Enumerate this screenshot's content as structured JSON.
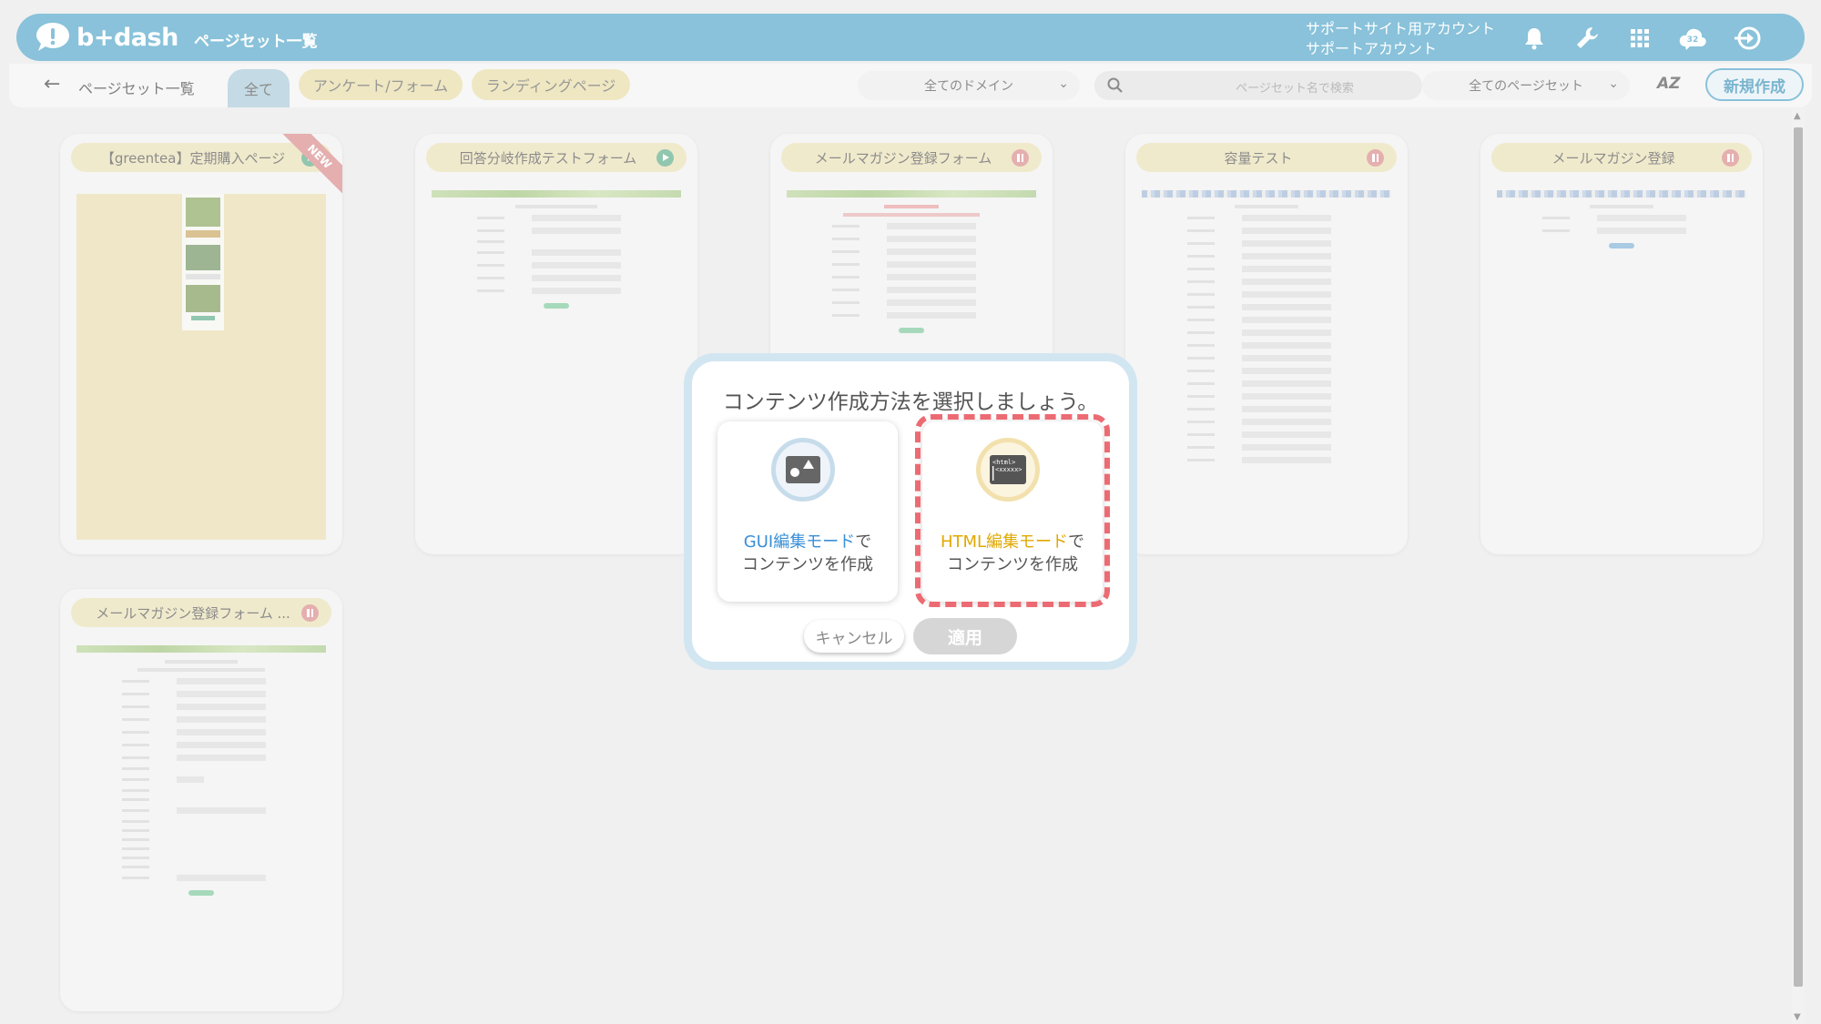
{
  "app": {
    "logo_text": "b+dash",
    "title": "ページセット一覧"
  },
  "account": {
    "line1": "サポートサイト用アカウント",
    "line2": "サポートアカウント"
  },
  "header_icons": [
    "bell-icon",
    "wrench-icon",
    "apps-grid-icon",
    "notification-cloud-icon",
    "logout-icon"
  ],
  "notification_count": "32",
  "toolbar": {
    "breadcrumb": "ページセット一覧",
    "tabs": [
      {
        "label": "全て",
        "active": true
      },
      {
        "label": "アンケート/フォーム",
        "active": false
      },
      {
        "label": "ランディングページ",
        "active": false
      }
    ],
    "domain_select": "全てのドメイン",
    "search_placeholder": "ページセット名で検索",
    "pageset_select": "全てのページセット",
    "sort_label": "AZ",
    "new_button": "新規作成"
  },
  "cards": [
    {
      "title": "【greentea】定期購入ページ",
      "status": "play",
      "new": true,
      "new_label": "NEW"
    },
    {
      "title": "回答分岐作成テストフォーム",
      "status": "play",
      "new": false
    },
    {
      "title": "メールマガジン登録フォーム",
      "status": "pause",
      "new": false
    },
    {
      "title": "容量テスト",
      "status": "pause",
      "new": false
    },
    {
      "title": "メールマガジン登録",
      "status": "pause",
      "new": false
    },
    {
      "title": "メールマガジン登録フォーム ...",
      "status": "pause",
      "new": false
    }
  ],
  "modal": {
    "title": "コンテンツ作成方法を選択しましょう。",
    "gui_option": {
      "highlight": "GUI編集モード",
      "suffix": "で",
      "line2": "コンテンツを作成"
    },
    "html_option": {
      "highlight": "HTML編集モード",
      "suffix": "で",
      "line2": "コンテンツを作成",
      "icon_text1": "<html>",
      "icon_text2": "<xxxxx>"
    },
    "cancel_label": "キャンセル",
    "apply_label": "適用"
  },
  "colors": {
    "header": "#52a6c9",
    "gui_accent": "#3a8fd6",
    "html_accent": "#e0a800",
    "highlight_border": "#ec6b73"
  }
}
